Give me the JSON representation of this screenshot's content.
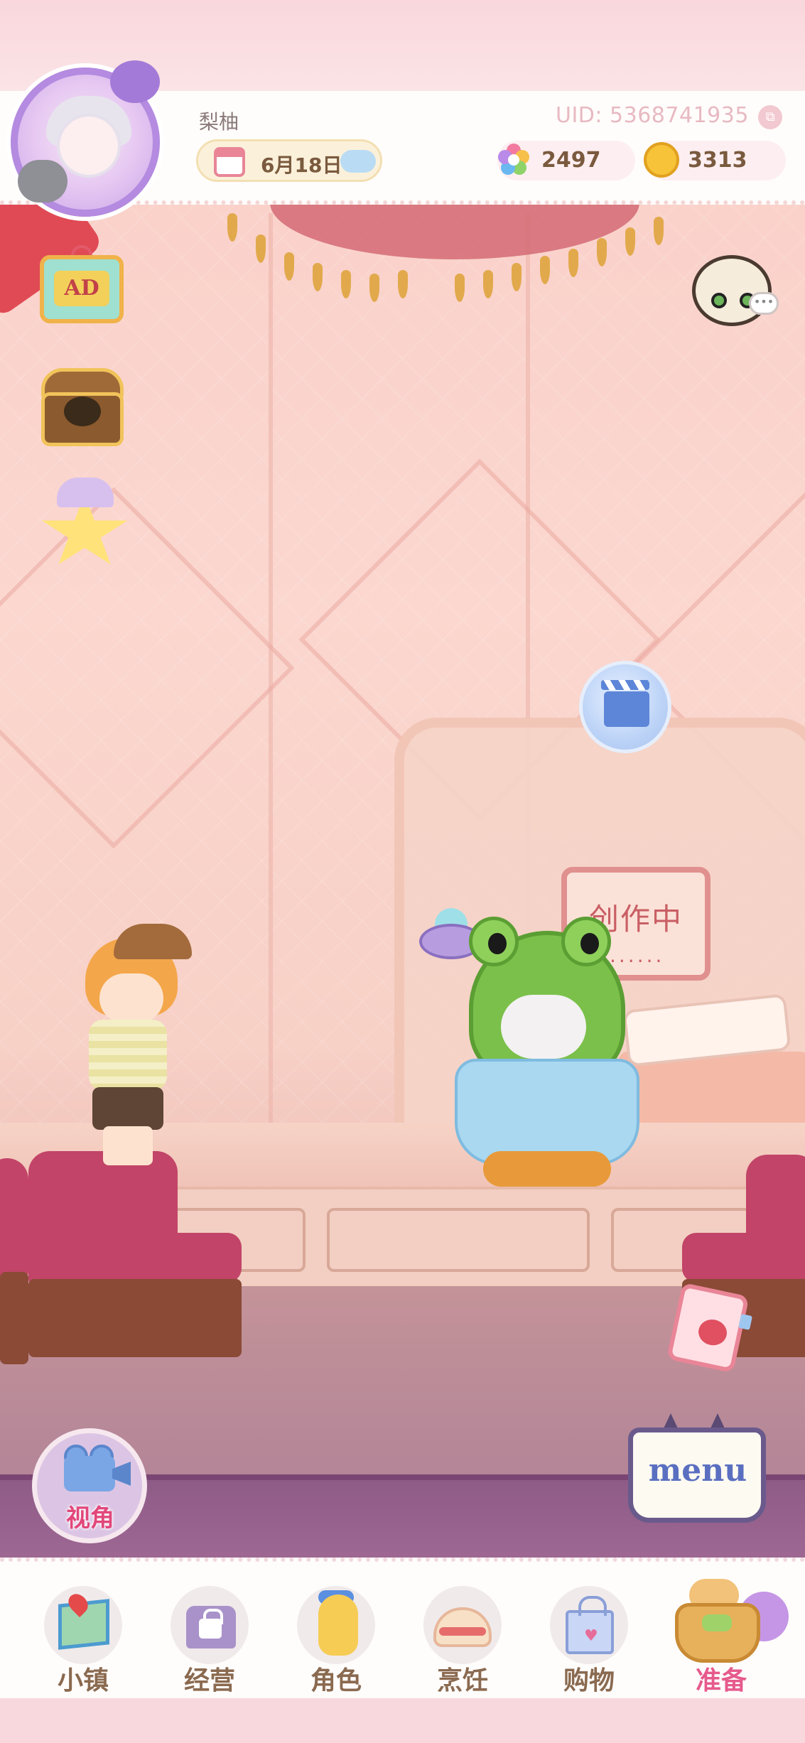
{
  "player": {
    "nickname": "梨柚",
    "uid": "UID: 5368741935",
    "date": "6月18日",
    "gems": "2497",
    "coins": "3313"
  },
  "side_buttons": {
    "ad_label": "AD"
  },
  "scene": {
    "board_sign": "创作中",
    "board_sign_dots": "......"
  },
  "menu": {
    "label": "menu"
  },
  "camera": {
    "label": "视角"
  },
  "nav": {
    "items": [
      {
        "label": "小镇",
        "icon": "map-icon"
      },
      {
        "label": "经营",
        "icon": "hat-lock-icon"
      },
      {
        "label": "角色",
        "icon": "doll-icon"
      },
      {
        "label": "烹饪",
        "icon": "cake-icon"
      },
      {
        "label": "购物",
        "icon": "shopping-bag-icon"
      },
      {
        "label": "准备",
        "icon": "picnic-basket-icon",
        "active": true
      }
    ]
  },
  "colors": {
    "accent_pink": "#e65a8c",
    "nav_text": "#8a6a50",
    "uid_text": "#e8b9c2"
  }
}
